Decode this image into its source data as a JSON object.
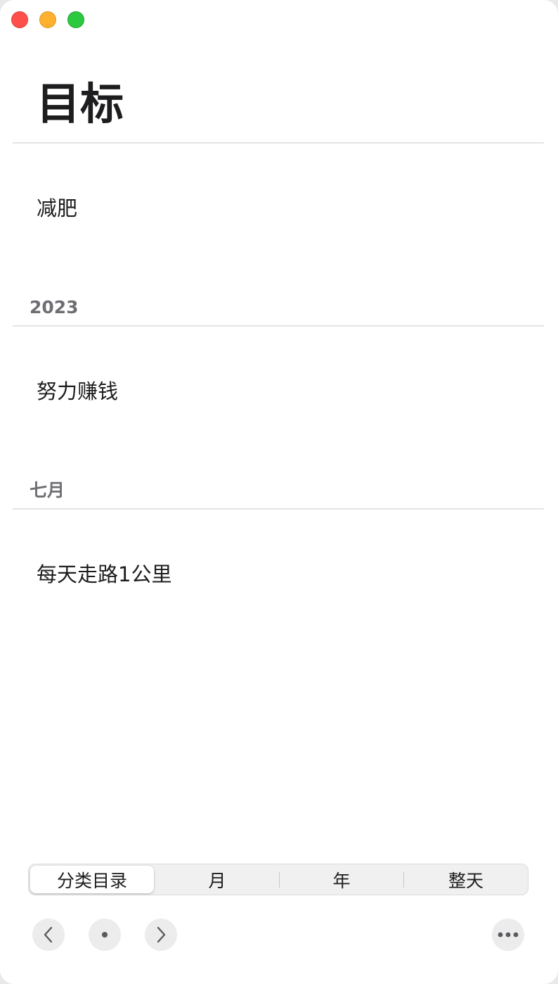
{
  "window": {
    "controls": [
      "close",
      "minimize",
      "maximize"
    ]
  },
  "page": {
    "title": "目标"
  },
  "goals": {
    "ungrouped": [
      "减肥"
    ],
    "sections": [
      {
        "header": "2023",
        "items": [
          "努力赚钱"
        ]
      },
      {
        "header": "七月",
        "items": [
          "每天走路1公里"
        ]
      }
    ]
  },
  "segmented_control": {
    "options": [
      "分类目录",
      "月",
      "年",
      "整天"
    ],
    "selected": "分类目录"
  },
  "toolbar": {
    "prev_icon": "chevron-left-icon",
    "today_icon": "dot-icon",
    "next_icon": "chevron-right-icon",
    "more_icon": "ellipsis-icon"
  }
}
